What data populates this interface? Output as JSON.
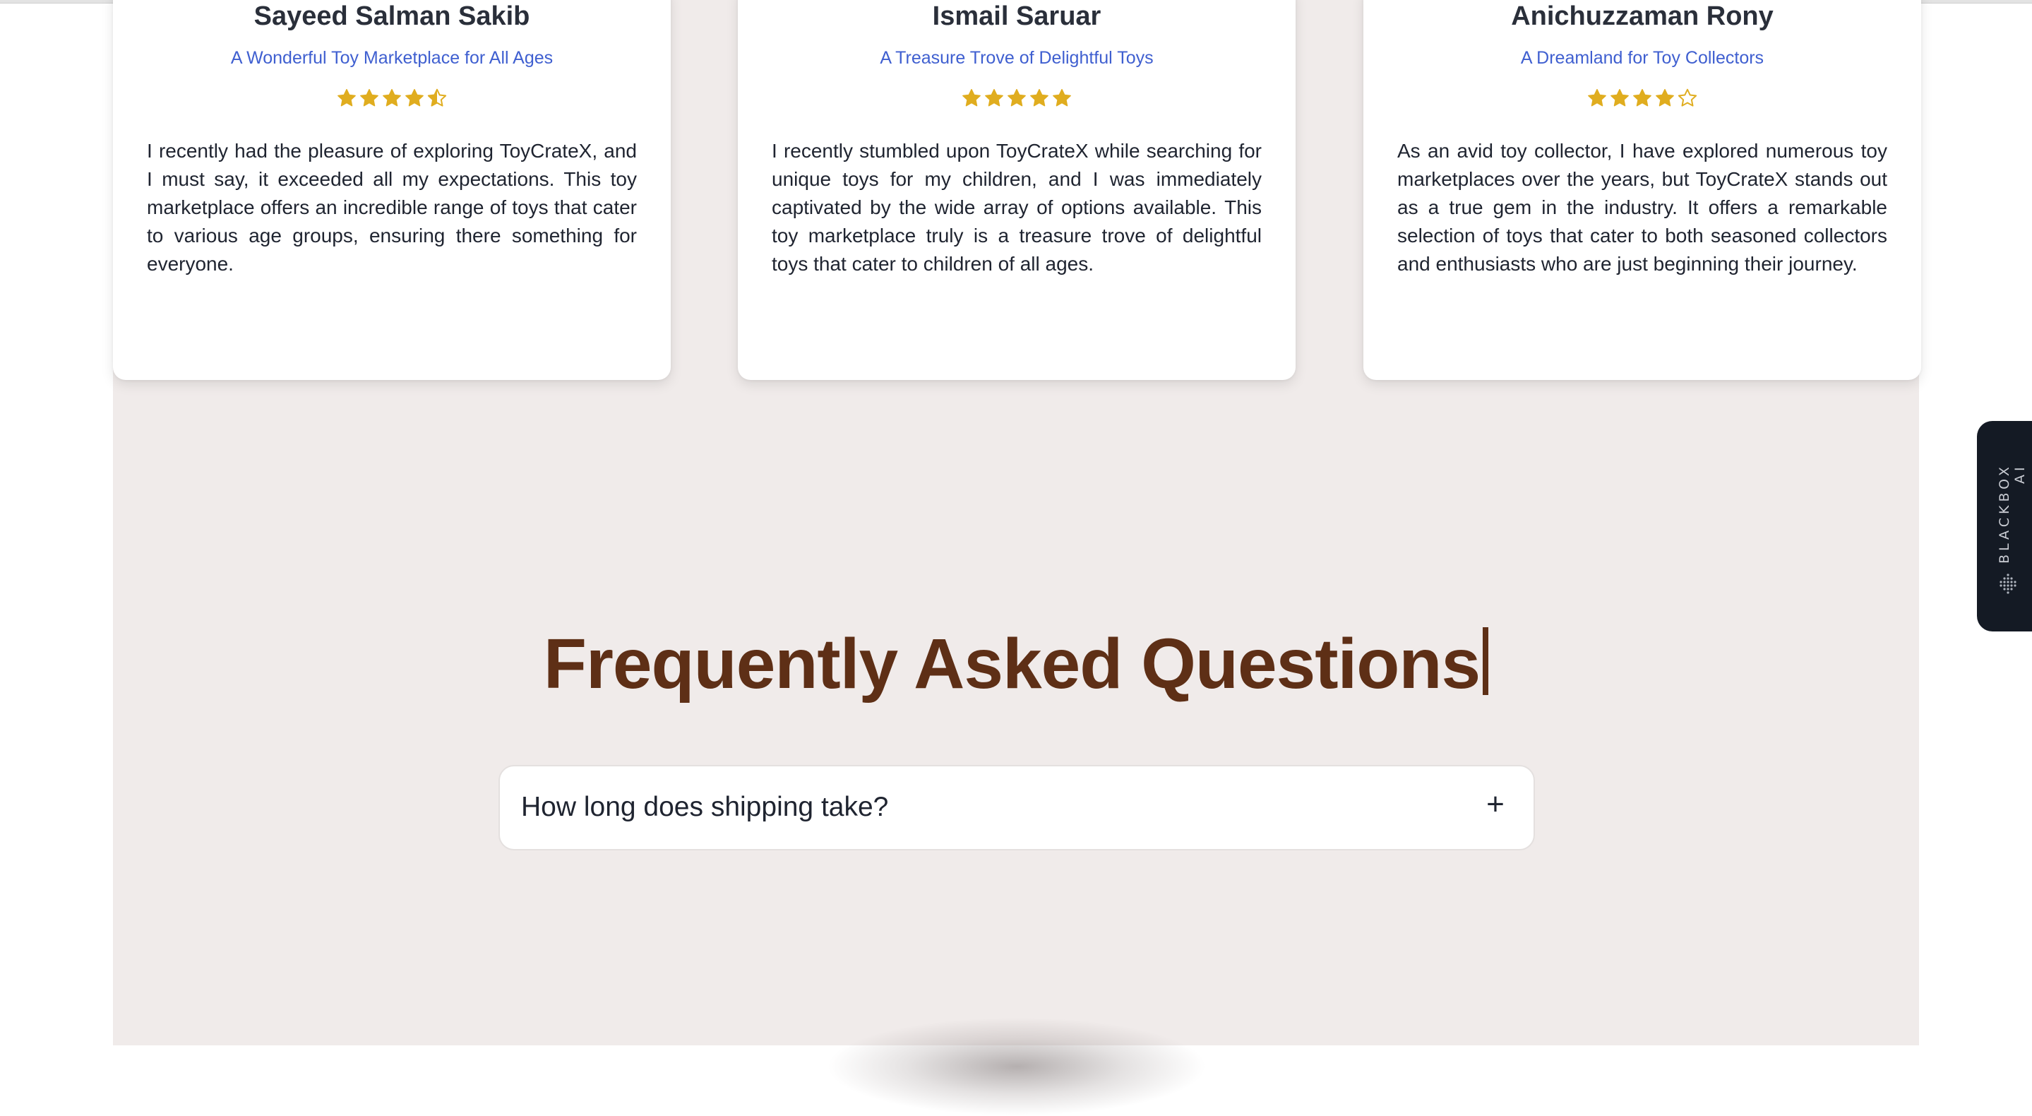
{
  "reviews": [
    {
      "name": "Sayeed Salman Sakib",
      "subtitle": "A Wonderful Toy Marketplace for All Ages",
      "rating": 4.5,
      "text": "I recently had the pleasure of exploring ToyCrateX, and I must say, it exceeded all my expectations. This toy marketplace offers an incredible range of toys that cater to various age groups, ensuring there something for everyone."
    },
    {
      "name": "Ismail Saruar",
      "subtitle": "A Treasure Trove of Delightful Toys",
      "rating": 5,
      "text": "I recently stumbled upon ToyCrateX while searching for unique toys for my children, and I was immediately captivated by the wide array of options available. This toy marketplace truly is a treasure trove of delightful toys that cater to children of all ages."
    },
    {
      "name": "Anichuzzaman Rony",
      "subtitle": "A Dreamland for Toy Collectors",
      "rating": 4,
      "text": "As an avid toy collector, I have explored numerous toy marketplaces over the years, but ToyCrateX stands out as a true gem in the industry. It offers a remarkable selection of toys that cater to both seasoned collectors and enthusiasts who are just beginning their journey."
    }
  ],
  "faq": {
    "title": "Frequently Asked Questions",
    "items": [
      {
        "question": "How long does shipping take?",
        "toggle": "+"
      }
    ]
  },
  "side_tab": {
    "label": "BLACKBOX AI",
    "icon": "blackbox-logo-icon"
  },
  "colors": {
    "star": "#e0ad1f",
    "subtitle": "#3f5fd0",
    "faq_title": "#5e2f16",
    "section_bg": "#f0ebea"
  }
}
